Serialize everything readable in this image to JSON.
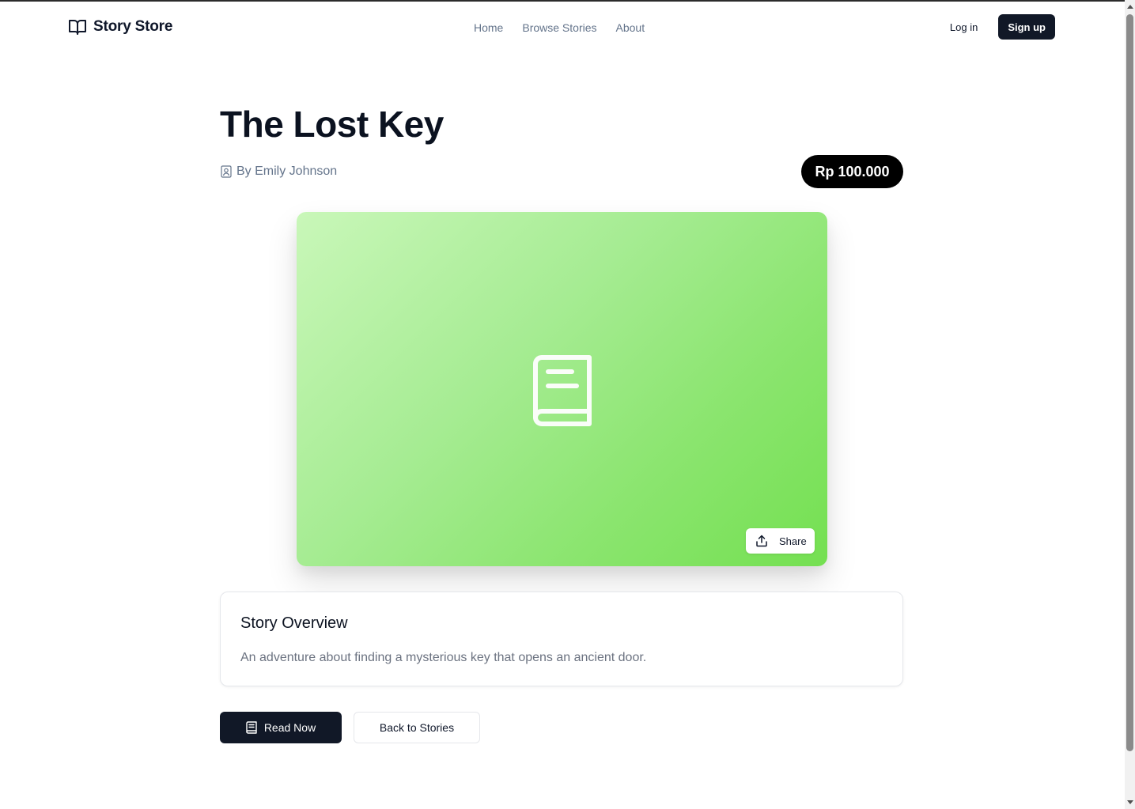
{
  "header": {
    "brand": "Story Store",
    "nav": [
      "Home",
      "Browse Stories",
      "About"
    ],
    "login_label": "Log in",
    "signup_label": "Sign up"
  },
  "story": {
    "title": "The Lost Key",
    "author": "By Emily Johnson",
    "price": "Rp 100.000",
    "cover_icon": "book-icon",
    "share_label": "Share"
  },
  "overview": {
    "heading": "Story Overview",
    "description": "An adventure about finding a mysterious key that opens an ancient door."
  },
  "actions": {
    "read_label": "Read Now",
    "back_label": "Back to Stories"
  },
  "colors": {
    "primary_dark": "#111827",
    "cover_gradient_start": "#c9f7b9",
    "cover_gradient_end": "#74e051",
    "muted_text": "#64748b"
  }
}
